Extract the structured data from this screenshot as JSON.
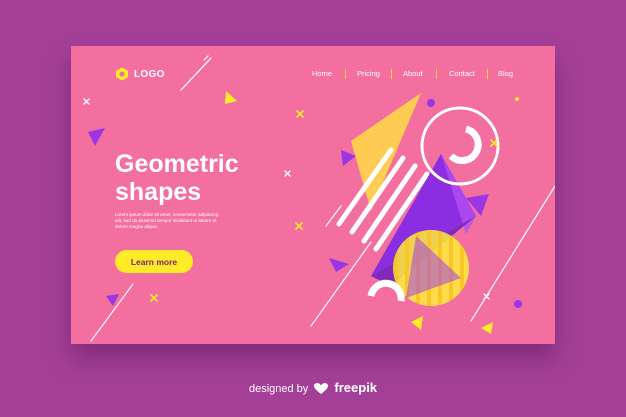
{
  "header": {
    "logo_text": "LOGO",
    "logo_icon": "hexagon-logo-icon",
    "nav": [
      {
        "label": "Home"
      },
      {
        "label": "Pricing"
      },
      {
        "label": "About"
      },
      {
        "label": "Contact"
      },
      {
        "label": "Blog"
      }
    ]
  },
  "hero": {
    "title_line1": "Geometric",
    "title_line2": "shapes",
    "description": "Lorem ipsum dolor sit amet, consectetur adipiscing elit, sed do eiusmod tempor incididunt ut labore et dolore magna aliqua.",
    "cta_label": "Learn more"
  },
  "credit": {
    "prefix": "designed by",
    "brand": "freepik",
    "icon": "freepik-heart-icon"
  },
  "colors": {
    "outer_background": "#a43f98",
    "page_background": "#f26fa0",
    "accent_yellow": "#ffec26",
    "accent_purple": "#8a2bd8",
    "text": "#ffffff"
  }
}
